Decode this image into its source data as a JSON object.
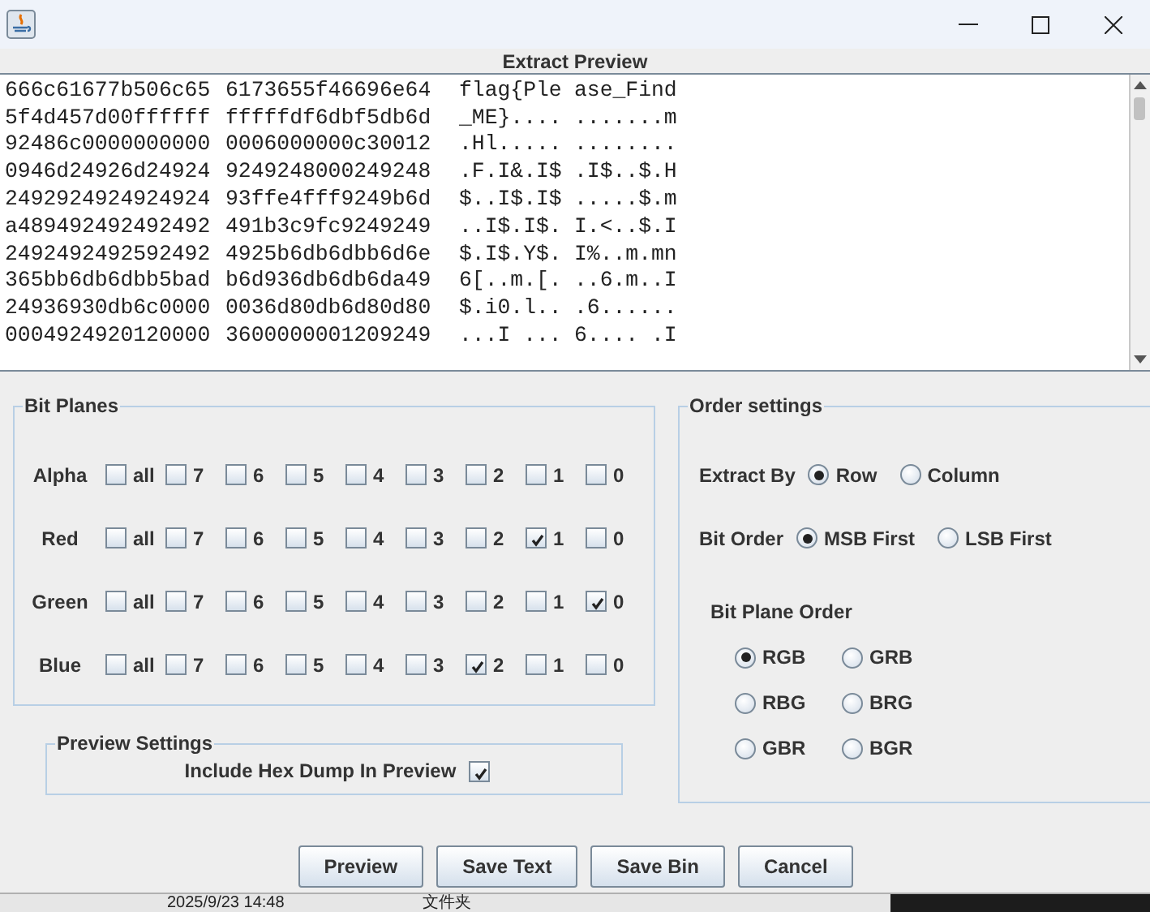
{
  "dialog": {
    "header": "Extract Preview"
  },
  "preview": {
    "rows": [
      {
        "hex_1": "666c61677b506c65",
        "hex_2": "6173655f46696e64",
        "ascii_1": "flag{Ple",
        "ascii_2": "ase_Find"
      },
      {
        "hex_1": "5f4d457d00ffffff",
        "hex_2": "fffffdf6dbf5db6d",
        "ascii_1": "_ME}....",
        "ascii_2": ".......m"
      },
      {
        "hex_1": "92486c0000000000",
        "hex_2": "0006000000c30012",
        "ascii_1": ".Hl.....",
        "ascii_2": "........"
      },
      {
        "hex_1": "0946d24926d24924",
        "hex_2": "9249248000249248",
        "ascii_1": ".F.I&.I$",
        "ascii_2": ".I$..$.H"
      },
      {
        "hex_1": "2492924924924924",
        "hex_2": "93ffe4fff9249b6d",
        "ascii_1": "$..I$.I$",
        "ascii_2": ".....$.m"
      },
      {
        "hex_1": "a489492492492492",
        "hex_2": "491b3c9fc9249249",
        "ascii_1": "..I$.I$.",
        "ascii_2": "I.<..$.I"
      },
      {
        "hex_1": "2492492492592492",
        "hex_2": "4925b6db6dbb6d6e",
        "ascii_1": "$.I$.Y$.",
        "ascii_2": "I%..m.mn"
      },
      {
        "hex_1": "365bb6db6dbb5bad",
        "hex_2": "b6d936db6db6da49",
        "ascii_1": "6[..m.[.",
        "ascii_2": "..6.m..I"
      },
      {
        "hex_1": "24936930db6c0000",
        "hex_2": "0036d80db6d80d80",
        "ascii_1": "$.i0.l..",
        "ascii_2": ".6......"
      },
      {
        "hex_1": "0004924920120000",
        "hex_2": "3600000001209249",
        "ascii_1": "...I ...",
        "ascii_2": "6.... .I"
      }
    ]
  },
  "bit_planes": {
    "title": "Bit Planes",
    "channels": [
      {
        "name": "Alpha",
        "bits": [
          {
            "label": "all",
            "checked": false
          },
          {
            "label": "7",
            "checked": false
          },
          {
            "label": "6",
            "checked": false
          },
          {
            "label": "5",
            "checked": false
          },
          {
            "label": "4",
            "checked": false
          },
          {
            "label": "3",
            "checked": false
          },
          {
            "label": "2",
            "checked": false
          },
          {
            "label": "1",
            "checked": false
          },
          {
            "label": "0",
            "checked": false
          }
        ]
      },
      {
        "name": "Red",
        "bits": [
          {
            "label": "all",
            "checked": false
          },
          {
            "label": "7",
            "checked": false
          },
          {
            "label": "6",
            "checked": false
          },
          {
            "label": "5",
            "checked": false
          },
          {
            "label": "4",
            "checked": false
          },
          {
            "label": "3",
            "checked": false
          },
          {
            "label": "2",
            "checked": false
          },
          {
            "label": "1",
            "checked": true
          },
          {
            "label": "0",
            "checked": false
          }
        ]
      },
      {
        "name": "Green",
        "bits": [
          {
            "label": "all",
            "checked": false
          },
          {
            "label": "7",
            "checked": false
          },
          {
            "label": "6",
            "checked": false
          },
          {
            "label": "5",
            "checked": false
          },
          {
            "label": "4",
            "checked": false
          },
          {
            "label": "3",
            "checked": false
          },
          {
            "label": "2",
            "checked": false
          },
          {
            "label": "1",
            "checked": false
          },
          {
            "label": "0",
            "checked": true
          }
        ]
      },
      {
        "name": "Blue",
        "bits": [
          {
            "label": "all",
            "checked": false
          },
          {
            "label": "7",
            "checked": false
          },
          {
            "label": "6",
            "checked": false
          },
          {
            "label": "5",
            "checked": false
          },
          {
            "label": "4",
            "checked": false
          },
          {
            "label": "3",
            "checked": false
          },
          {
            "label": "2",
            "checked": true
          },
          {
            "label": "1",
            "checked": false
          },
          {
            "label": "0",
            "checked": false
          }
        ]
      }
    ]
  },
  "preview_settings": {
    "title": "Preview Settings",
    "include_hex_dump": {
      "label": "Include Hex Dump In Preview",
      "checked": true
    }
  },
  "order_settings": {
    "title": "Order settings",
    "extract_by": {
      "label": "Extract By",
      "options": [
        {
          "label": "Row",
          "selected": true
        },
        {
          "label": "Column",
          "selected": false
        }
      ]
    },
    "bit_order": {
      "label": "Bit Order",
      "options": [
        {
          "label": "MSB First",
          "selected": true
        },
        {
          "label": "LSB First",
          "selected": false
        }
      ]
    },
    "bit_plane_order": {
      "label": "Bit Plane Order",
      "options": [
        {
          "label": "RGB",
          "selected": true
        },
        {
          "label": "GRB",
          "selected": false
        },
        {
          "label": "RBG",
          "selected": false
        },
        {
          "label": "BRG",
          "selected": false
        },
        {
          "label": "GBR",
          "selected": false
        },
        {
          "label": "BGR",
          "selected": false
        }
      ]
    }
  },
  "buttons": [
    {
      "label": "Preview"
    },
    {
      "label": "Save Text"
    },
    {
      "label": "Save Bin"
    },
    {
      "label": "Cancel"
    }
  ],
  "background": {
    "date": "2025/9/23 14:48",
    "type": "文件夹"
  }
}
